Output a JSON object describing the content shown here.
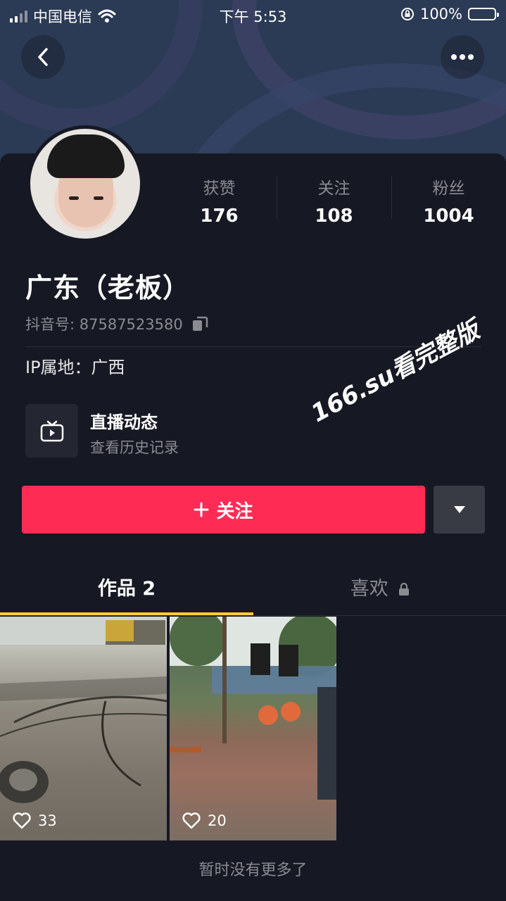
{
  "status_bar": {
    "carrier": "中国电信",
    "time": "下午 5:53",
    "battery": "100%"
  },
  "header": {
    "back_icon": "chevron-left-icon",
    "more_icon": "ellipsis-icon"
  },
  "profile": {
    "stats": [
      {
        "label": "获赞",
        "value": "176"
      },
      {
        "label": "关注",
        "value": "108"
      },
      {
        "label": "粉丝",
        "value": "1004"
      }
    ],
    "name": "广东（老板）",
    "douyin_id": "抖音号: 87587523580",
    "ip_location": "IP属地：广西"
  },
  "live": {
    "title": "直播动态",
    "subtitle": "查看历史记录"
  },
  "watermark": "166.su看完整版",
  "actions": {
    "follow_label": "关注",
    "accent_color": "#fe2c55"
  },
  "tabs": {
    "works": "作品 2",
    "likes": "喜欢"
  },
  "videos": [
    {
      "likes": "33"
    },
    {
      "likes": "20"
    }
  ],
  "footer": {
    "no_more": "暂时没有更多了"
  }
}
